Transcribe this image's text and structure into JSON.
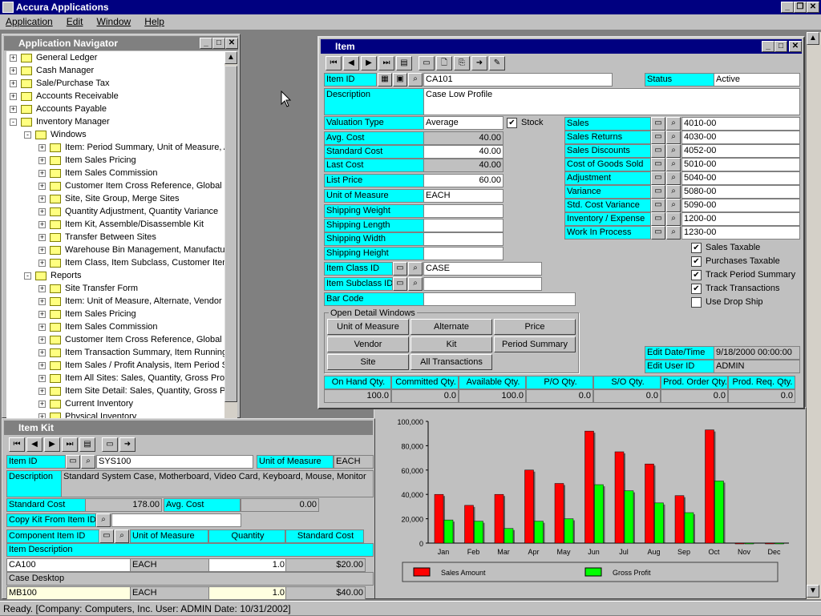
{
  "app": {
    "title": "Accura Applications",
    "menus": [
      "Application",
      "Edit",
      "Window",
      "Help"
    ]
  },
  "navigator": {
    "title": "Application Navigator",
    "items": [
      {
        "label": "General Ledger",
        "level": 0,
        "sign": "+"
      },
      {
        "label": "Cash Manager",
        "level": 0,
        "sign": "+"
      },
      {
        "label": "Sale/Purchase Tax",
        "level": 0,
        "sign": "+"
      },
      {
        "label": "Accounts Receivable",
        "level": 0,
        "sign": "+"
      },
      {
        "label": "Accounts Payable",
        "level": 0,
        "sign": "+"
      },
      {
        "label": "Inventory Manager",
        "level": 0,
        "sign": "-"
      },
      {
        "label": "Windows",
        "level": 1,
        "sign": "-"
      },
      {
        "label": "Item: Period Summary, Unit of Measure, A",
        "level": 2,
        "sign": "+"
      },
      {
        "label": "Item Sales Pricing",
        "level": 2,
        "sign": "+"
      },
      {
        "label": "Item Sales Commission",
        "level": 2,
        "sign": "+"
      },
      {
        "label": "Customer Item Cross Reference, Global I",
        "level": 2,
        "sign": "+"
      },
      {
        "label": "Site, Site Group, Merge Sites",
        "level": 2,
        "sign": "+"
      },
      {
        "label": "Quantity Adjustment, Quantity Variance",
        "level": 2,
        "sign": "+"
      },
      {
        "label": "Item Kit, Assemble/Disassemble Kit",
        "level": 2,
        "sign": "+"
      },
      {
        "label": "Transfer Between Sites",
        "level": 2,
        "sign": "+"
      },
      {
        "label": "Warehouse Bin Management, Manufactu",
        "level": 2,
        "sign": "+"
      },
      {
        "label": "Item Class, Item Subclass, Customer Item",
        "level": 2,
        "sign": "+"
      },
      {
        "label": "Reports",
        "level": 1,
        "sign": "-"
      },
      {
        "label": "Site Transfer Form",
        "level": 2,
        "sign": "+"
      },
      {
        "label": "Item: Unit of Measure, Alternate, Vendor",
        "level": 2,
        "sign": "+"
      },
      {
        "label": "Item Sales Pricing",
        "level": 2,
        "sign": "+"
      },
      {
        "label": "Item Sales Commission",
        "level": 2,
        "sign": "+"
      },
      {
        "label": "Customer Item Cross Reference, Global I",
        "level": 2,
        "sign": "+"
      },
      {
        "label": "Item Transaction Summary, Item Running",
        "level": 2,
        "sign": "+"
      },
      {
        "label": "Item Sales / Profit Analysis, Item Period S",
        "level": 2,
        "sign": "+"
      },
      {
        "label": "Item All Sites: Sales, Quantity, Gross Pro",
        "level": 2,
        "sign": "+"
      },
      {
        "label": "Item Site Detail: Sales, Quantity, Gross Pr",
        "level": 2,
        "sign": "+"
      },
      {
        "label": "Current Inventory",
        "level": 2,
        "sign": "+"
      },
      {
        "label": "Physical Inventory",
        "level": 2,
        "sign": "+"
      }
    ]
  },
  "item": {
    "title": "Item",
    "item_id_label": "Item ID",
    "item_id": "CA101",
    "status_label": "Status",
    "status": "Active",
    "desc_label": "Description",
    "desc": "Case Low Profile",
    "valuation_label": "Valuation Type",
    "valuation": "Average",
    "stock_label": "Stock",
    "avg_cost_label": "Avg. Cost",
    "avg_cost": "40.00",
    "std_cost_label": "Standard Cost",
    "std_cost": "40.00",
    "last_cost_label": "Last Cost",
    "last_cost": "40.00",
    "list_price_label": "List Price",
    "list_price": "60.00",
    "uom_label": "Unit of Measure",
    "uom": "EACH",
    "ship_weight": "Shipping Weight",
    "ship_length": "Shipping Length",
    "ship_width": "Shipping Width",
    "ship_height": "Shipping Height",
    "class_label": "Item Class ID",
    "class": "CASE",
    "subclass_label": "Item Subclass ID",
    "subclass": "",
    "barcode_label": "Bar Code",
    "barcode": "",
    "accounts": [
      {
        "label": "Sales",
        "value": "4010-00"
      },
      {
        "label": "Sales Returns",
        "value": "4030-00"
      },
      {
        "label": "Sales Discounts",
        "value": "4052-00"
      },
      {
        "label": "Cost of Goods Sold",
        "value": "5010-00"
      },
      {
        "label": "Adjustment",
        "value": "5040-00"
      },
      {
        "label": "Variance",
        "value": "5080-00"
      },
      {
        "label": "Std. Cost Variance",
        "value": "5090-00"
      },
      {
        "label": "Inventory / Expense",
        "value": "1200-00"
      },
      {
        "label": "Work In Process",
        "value": "1230-00"
      }
    ],
    "checks": [
      {
        "label": "Sales Taxable",
        "checked": true
      },
      {
        "label": "Purchases Taxable",
        "checked": true
      },
      {
        "label": "Track Period Summary",
        "checked": true
      },
      {
        "label": "Track Transactions",
        "checked": true
      },
      {
        "label": "Use Drop Ship",
        "checked": false
      }
    ],
    "detail_title": "Open Detail Windows",
    "detail_buttons": [
      "Unit of Measure",
      "Alternate",
      "Price",
      "Vendor",
      "Kit",
      "Period Summary",
      "Site",
      "All Transactions"
    ],
    "edit_date_label": "Edit Date/Time",
    "edit_date": "9/18/2000 00:00:00",
    "edit_user_label": "Edit User ID",
    "edit_user": "ADMIN",
    "qty_headers": [
      "On Hand Qty.",
      "Committed Qty.",
      "Available Qty.",
      "P/O Qty.",
      "S/O Qty.",
      "Prod. Order Qty.",
      "Prod. Req. Qty."
    ],
    "qty_values": [
      "100.0",
      "0.0",
      "100.0",
      "0.0",
      "0.0",
      "0.0",
      "0.0"
    ]
  },
  "kit": {
    "title": "Item Kit",
    "item_id_label": "Item ID",
    "item_id": "SYS100",
    "uom_label": "Unit of Measure",
    "uom": "EACH",
    "desc_label": "Description",
    "desc": "Standard System Case, Motherboard, Video Card, Keyboard, Mouse, Monitor",
    "std_cost_label": "Standard Cost",
    "std_cost": "178.00",
    "avg_cost_label": "Avg. Cost",
    "avg_cost": "0.00",
    "copy_label": "Copy Kit From Item ID",
    "col_component": "Component Item ID",
    "col_uom": "Unit of Measure",
    "col_qty": "Quantity",
    "col_cost": "Standard Cost",
    "col_itemdesc": "Item Description",
    "rows": [
      {
        "id": "CA100",
        "uom": "EACH",
        "qty": "1.0",
        "cost": "$20.00",
        "desc": "Case Desktop"
      },
      {
        "id": "MB100",
        "uom": "EACH",
        "qty": "1.0",
        "cost": "$40.00",
        "desc": ""
      }
    ]
  },
  "statusbar": "Ready.  [Company: Computers, Inc. User: ADMIN Date: 10/31/2002]",
  "chart_data": {
    "type": "bar",
    "categories": [
      "Jan",
      "Feb",
      "Mar",
      "Apr",
      "May",
      "Jun",
      "Jul",
      "Aug",
      "Sep",
      "Oct",
      "Nov",
      "Dec"
    ],
    "series": [
      {
        "name": "Sales Amount",
        "color": "#ff0000",
        "values": [
          40000,
          31000,
          40000,
          60000,
          49000,
          92000,
          75000,
          65000,
          39000,
          93000,
          0,
          0
        ]
      },
      {
        "name": "Gross Profit",
        "color": "#00ff00",
        "values": [
          19000,
          18000,
          12000,
          18000,
          20000,
          48000,
          43000,
          33000,
          25000,
          51000,
          0,
          0
        ]
      }
    ],
    "ylim": [
      0,
      100000
    ],
    "yticks": [
      "100,000",
      "80,000",
      "60,000",
      "40,000",
      "20,000",
      "0"
    ],
    "legend": "bottom"
  }
}
